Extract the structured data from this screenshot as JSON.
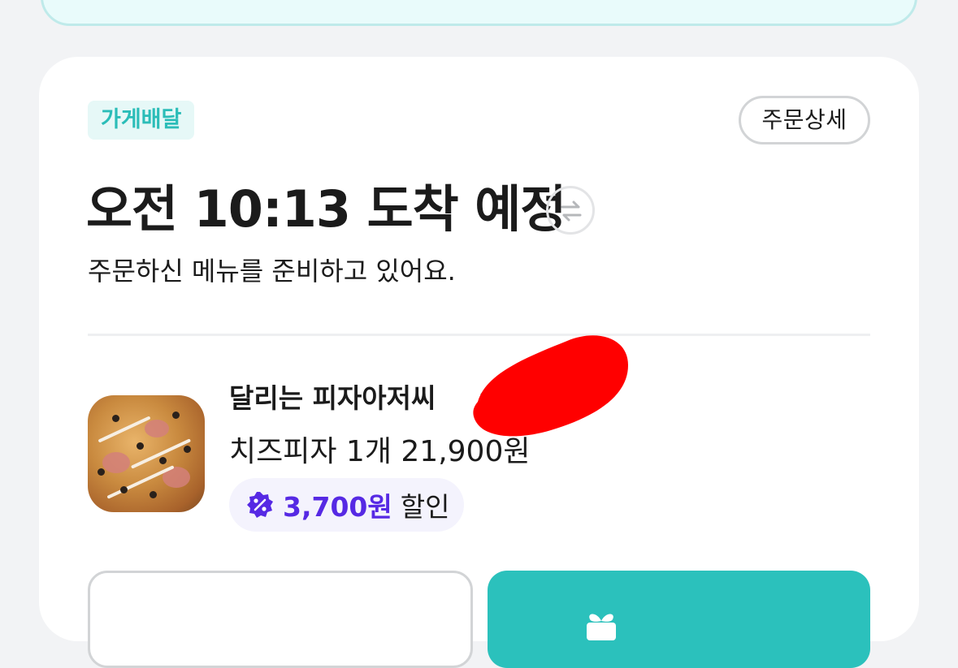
{
  "order": {
    "delivery_type": "가게배달",
    "detail_button": "주문상세",
    "eta": "오전 10:13 도착 예정",
    "status": "주문하신 메뉴를 준비하고 있어요.",
    "store_name": "달리는 피자아저씨",
    "items_summary": "치즈피자 1개 21,900원",
    "discount": {
      "amount": "3,700원",
      "label": "할인"
    }
  },
  "actions": {
    "left_label": "",
    "right_label": ""
  },
  "icons": {
    "swap": "swap-arrows-icon",
    "chevron": "chevron-right-icon",
    "discount": "percent-badge-icon",
    "gift": "gift-icon"
  },
  "colors": {
    "accent_mint": "#2bc1bc",
    "tag_text": "#2bbdb8",
    "discount_purple": "#5629e4",
    "background": "#f2f3f5"
  }
}
